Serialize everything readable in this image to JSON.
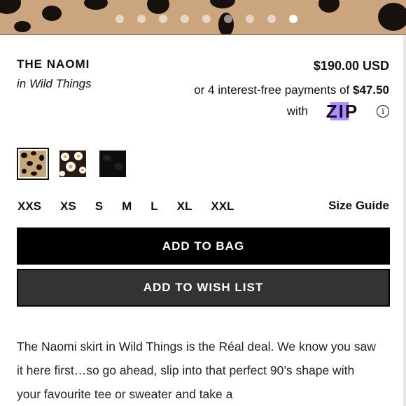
{
  "gallery": {
    "dot_count": 9,
    "active_index": 8
  },
  "product": {
    "name": "THE NAOMI",
    "print": "in Wild Things",
    "price": "$190.00 USD",
    "installments_prefix": "or 4 interest-free payments of ",
    "installment_amount": "$47.50",
    "with_label": "with",
    "zip_logo_text": "ZIP",
    "info_glyph": "i"
  },
  "swatches": [
    {
      "name": "leopard",
      "selected": true
    },
    {
      "name": "daisy",
      "selected": false
    },
    {
      "name": "black",
      "selected": false
    }
  ],
  "sizes": [
    "XXS",
    "XS",
    "S",
    "M",
    "L",
    "XL",
    "XXL"
  ],
  "size_guide_label": "Size Guide",
  "actions": {
    "add_to_bag": "ADD TO BAG",
    "add_to_wish_list": "ADD TO WISH LIST"
  },
  "description": "The Naomi skirt in Wild Things is the Réal deal. We know you saw it here first…so go ahead, slip into that perfect 90’s shape with your favourite tee or sweater and take a",
  "colors": {
    "zip_purple": "#aa8fff",
    "zip_dark": "#1a0826",
    "button_black": "#000000",
    "button_dark_gray": "#333333"
  }
}
